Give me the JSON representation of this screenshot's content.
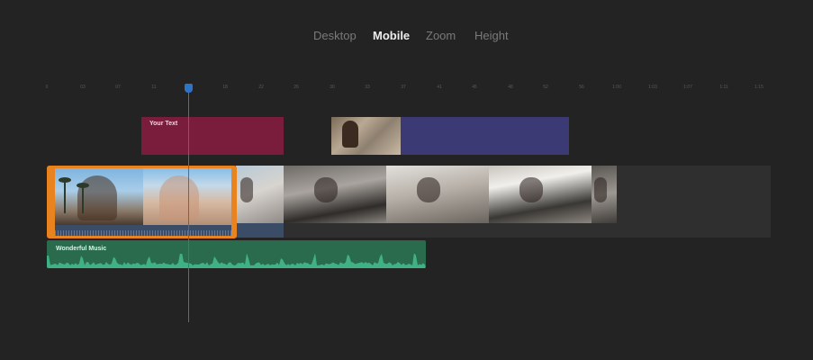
{
  "tabs": [
    {
      "label": "Desktop",
      "active": false
    },
    {
      "label": "Mobile",
      "active": true
    },
    {
      "label": "Zoom",
      "active": false
    },
    {
      "label": "Height",
      "active": false
    }
  ],
  "ruler": {
    "ticks": [
      "0",
      "03",
      "07",
      "11",
      "15",
      "18",
      "22",
      "26",
      "30",
      "33",
      "37",
      "41",
      "45",
      "48",
      "52",
      "56",
      "1:00",
      "1:03",
      "1:07",
      "1:11",
      "1:15"
    ]
  },
  "clips": {
    "text_clip": {
      "label": "Your Text"
    },
    "music_clip": {
      "label": "Wonderful Music"
    }
  },
  "colors": {
    "background": "#232323",
    "text_clip": "#7a1d3d",
    "overlay_clip": "#3c3a75",
    "selected_border": "#e8831f",
    "music_clip": "#2a6b4e",
    "waveform": "#3fb184",
    "playhead": "#2d74c9"
  }
}
